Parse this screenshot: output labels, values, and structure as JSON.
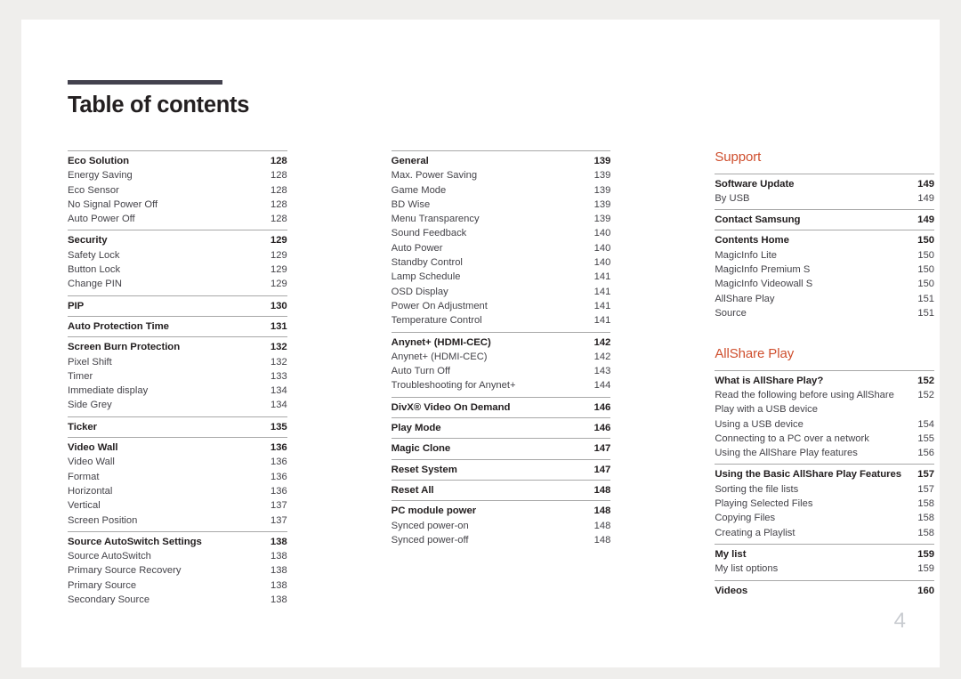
{
  "document": {
    "title": "Table of contents",
    "folio": "4",
    "accent_color": "#cf4f2e",
    "rule_color": "#43424e"
  },
  "columns": [
    {
      "name": "column-1",
      "heading": null,
      "groups": [
        {
          "head": {
            "label": "Eco Solution",
            "page": "128"
          },
          "items": [
            {
              "label": "Energy Saving",
              "page": "128"
            },
            {
              "label": "Eco Sensor",
              "page": "128"
            },
            {
              "label": "No Signal Power Off",
              "page": "128"
            },
            {
              "label": "Auto Power Off",
              "page": "128"
            }
          ]
        },
        {
          "head": {
            "label": "Security",
            "page": "129"
          },
          "items": [
            {
              "label": "Safety Lock",
              "page": "129"
            },
            {
              "label": "Button Lock",
              "page": "129"
            },
            {
              "label": "Change PIN",
              "page": "129"
            }
          ]
        },
        {
          "head": {
            "label": "PIP",
            "page": "130"
          },
          "items": []
        },
        {
          "head": {
            "label": "Auto Protection Time",
            "page": "131"
          },
          "items": []
        },
        {
          "head": {
            "label": "Screen Burn Protection",
            "page": "132"
          },
          "items": [
            {
              "label": "Pixel Shift",
              "page": "132"
            },
            {
              "label": "Timer",
              "page": "133"
            },
            {
              "label": "Immediate display",
              "page": "134"
            },
            {
              "label": "Side Grey",
              "page": "134"
            }
          ]
        },
        {
          "head": {
            "label": "Ticker",
            "page": "135"
          },
          "items": []
        },
        {
          "head": {
            "label": "Video Wall",
            "page": "136"
          },
          "items": [
            {
              "label": "Video Wall",
              "page": "136"
            },
            {
              "label": "Format",
              "page": "136"
            },
            {
              "label": "Horizontal",
              "page": "136"
            },
            {
              "label": "Vertical",
              "page": "137"
            },
            {
              "label": "Screen Position",
              "page": "137"
            }
          ]
        },
        {
          "head": {
            "label": "Source AutoSwitch Settings",
            "page": "138"
          },
          "items": [
            {
              "label": "Source AutoSwitch",
              "page": "138"
            },
            {
              "label": "Primary Source Recovery",
              "page": "138"
            },
            {
              "label": "Primary Source",
              "page": "138"
            },
            {
              "label": "Secondary Source",
              "page": "138"
            }
          ]
        }
      ]
    },
    {
      "name": "column-2",
      "heading": null,
      "groups": [
        {
          "head": {
            "label": "General",
            "page": "139"
          },
          "items": [
            {
              "label": "Max. Power Saving",
              "page": "139"
            },
            {
              "label": "Game Mode",
              "page": "139"
            },
            {
              "label": "BD Wise",
              "page": "139"
            },
            {
              "label": "Menu Transparency",
              "page": "139"
            },
            {
              "label": "Sound Feedback",
              "page": "140"
            },
            {
              "label": "Auto Power",
              "page": "140"
            },
            {
              "label": "Standby Control",
              "page": "140"
            },
            {
              "label": "Lamp Schedule",
              "page": "141"
            },
            {
              "label": "OSD Display",
              "page": "141"
            },
            {
              "label": "Power On Adjustment",
              "page": "141"
            },
            {
              "label": "Temperature Control",
              "page": "141"
            }
          ]
        },
        {
          "head": {
            "label": "Anynet+ (HDMI-CEC)",
            "page": "142"
          },
          "items": [
            {
              "label": "Anynet+ (HDMI-CEC)",
              "page": "142"
            },
            {
              "label": "Auto Turn Off",
              "page": "143"
            },
            {
              "label": "Troubleshooting for Anynet+",
              "page": "144"
            }
          ]
        },
        {
          "head": {
            "label": "DivX® Video On Demand",
            "page": "146"
          },
          "items": []
        },
        {
          "head": {
            "label": "Play Mode",
            "page": "146"
          },
          "items": []
        },
        {
          "head": {
            "label": "Magic Clone",
            "page": "147"
          },
          "items": []
        },
        {
          "head": {
            "label": "Reset System",
            "page": "147"
          },
          "items": []
        },
        {
          "head": {
            "label": "Reset All",
            "page": "148"
          },
          "items": []
        },
        {
          "head": {
            "label": "PC module power",
            "page": "148"
          },
          "items": [
            {
              "label": "Synced power-on",
              "page": "148"
            },
            {
              "label": "Synced power-off",
              "page": "148"
            }
          ]
        }
      ]
    },
    {
      "name": "column-3",
      "heading": "Support",
      "heading2": "AllShare Play",
      "groups": [
        {
          "head": {
            "label": "Software Update",
            "page": "149"
          },
          "items": [
            {
              "label": "By USB",
              "page": "149"
            }
          ]
        },
        {
          "head": {
            "label": "Contact Samsung",
            "page": "149"
          },
          "items": []
        },
        {
          "head": {
            "label": "Contents Home",
            "page": "150"
          },
          "items": [
            {
              "label": "MagicInfo Lite",
              "page": "150"
            },
            {
              "label": "MagicInfo Premium S",
              "page": "150"
            },
            {
              "label": "MagicInfo Videowall S",
              "page": "150"
            },
            {
              "label": "AllShare Play",
              "page": "151"
            },
            {
              "label": "Source",
              "page": "151"
            }
          ]
        }
      ],
      "groups2": [
        {
          "head": {
            "label": "What is AllShare Play?",
            "page": "152"
          },
          "items": [
            {
              "label": "Read the following before using AllShare Play with a USB device",
              "page": "152",
              "wrap": true
            },
            {
              "label": "Using a USB device",
              "page": "154"
            },
            {
              "label": "Connecting to a PC over a network",
              "page": "155"
            },
            {
              "label": "Using the AllShare Play features",
              "page": "156"
            }
          ]
        },
        {
          "head": {
            "label": "Using the Basic AllShare Play Features",
            "page": "157"
          },
          "items": [
            {
              "label": "Sorting the file lists",
              "page": "157"
            },
            {
              "label": "Playing Selected Files",
              "page": "158"
            },
            {
              "label": "Copying Files",
              "page": "158"
            },
            {
              "label": "Creating a Playlist",
              "page": "158"
            }
          ]
        },
        {
          "head": {
            "label": "My list",
            "page": "159"
          },
          "items": [
            {
              "label": "My list options",
              "page": "159"
            }
          ]
        },
        {
          "head": {
            "label": "Videos",
            "page": "160"
          },
          "items": []
        }
      ]
    }
  ]
}
